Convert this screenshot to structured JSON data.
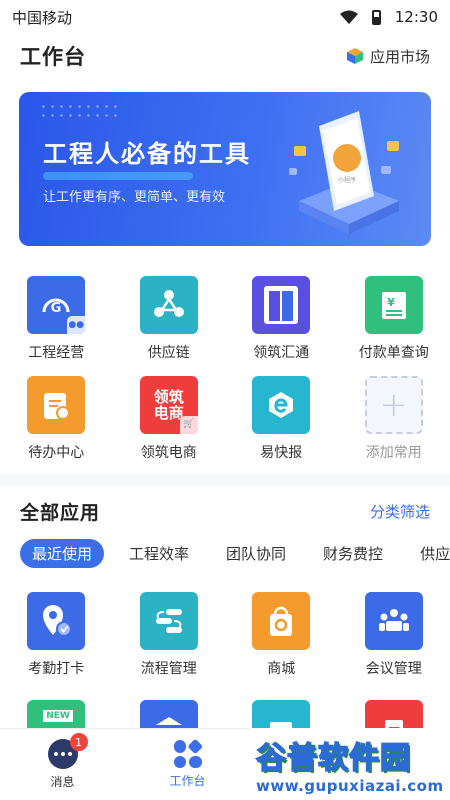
{
  "status_bar": {
    "carrier": "中国移动",
    "time": "12:30"
  },
  "header": {
    "title": "工作台",
    "app_market_label": "应用市场"
  },
  "banner": {
    "title": "工程人必备的工具",
    "subtitle": "让工作更有序、更简单、更有效",
    "art_caption": "小程序"
  },
  "quick_apps": [
    {
      "label": "工程经营",
      "icon": "engineering-icon",
      "color": "#3d6be8"
    },
    {
      "label": "供应链",
      "icon": "supply-chain-icon",
      "color": "#2bb3c4"
    },
    {
      "label": "领筑汇通",
      "icon": "huitong-icon",
      "color": "#5a4fe0"
    },
    {
      "label": "付款单查询",
      "icon": "payment-icon",
      "color": "#2fc07e"
    },
    {
      "label": "待办中心",
      "icon": "todo-icon",
      "color": "#f59a2c"
    },
    {
      "label": "领筑电商",
      "icon": "ecommerce-icon",
      "color": "#ef3d3d",
      "glyph": "领筑电商"
    },
    {
      "label": "易快报",
      "icon": "yikuaibao-icon",
      "color": "#27b6d0"
    },
    {
      "label": "添加常用",
      "icon": "add-icon"
    }
  ],
  "all_apps": {
    "title": "全部应用",
    "filter_label": "分类筛选",
    "tabs": [
      "最近使用",
      "工程效率",
      "团队协同",
      "财务费控",
      "供应链"
    ],
    "active_tab": 0,
    "items": [
      {
        "label": "考勤打卡",
        "icon": "attendance-icon",
        "color": "#3d6be8"
      },
      {
        "label": "流程管理",
        "icon": "workflow-icon",
        "color": "#2bb3c4"
      },
      {
        "label": "商城",
        "icon": "mall-icon",
        "color": "#f59a2c"
      },
      {
        "label": "会议管理",
        "icon": "meeting-icon",
        "color": "#3d6be8"
      }
    ],
    "partial_row": [
      {
        "icon": "new-app-icon",
        "color": "#2fc07e",
        "tag": "NEW"
      },
      {
        "icon": "video-app-icon",
        "color": "#3d6be8"
      },
      {
        "icon": "ticket-app-icon",
        "color": "#27b6d0"
      },
      {
        "icon": "report-app-icon",
        "color": "#ef3d3d"
      }
    ]
  },
  "bottom_nav": {
    "messages_label": "消息",
    "messages_badge": "1",
    "workbench_label": "工作台"
  },
  "watermark": {
    "main": "谷普软件园",
    "sub": "www.gupuxiazai.com"
  }
}
